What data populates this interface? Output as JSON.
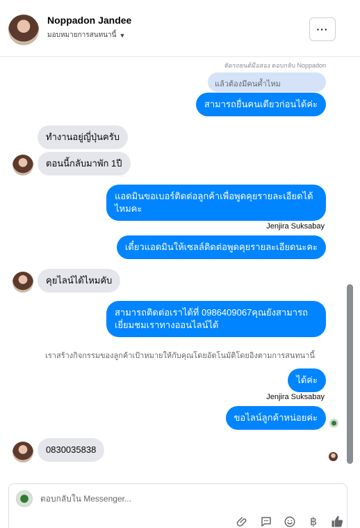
{
  "header": {
    "name": "Noppadon Jandee",
    "subtitle": "มอบหมายการสนทนานี้",
    "more_label": "···"
  },
  "messages": {
    "reply_context": "ตัดรถยนต์มือสอง ตอบกลับ Noppadon",
    "quoted_text": "แล้วต้องมีคนค้ำไหม",
    "m1": "สามารถยื่นคนเดียวก่อนได้ค่ะ",
    "m2": "ทำงานอยู่ญี่ปุ่นครับ",
    "m3": "ตอนนี้กลับมาพัก 1ปี",
    "m4": "แอดมินขอเบอร์ติดต่อลูกค้าเพื่อพูดคุยรายละเอียดได้ไหมคะ",
    "m4_sender": "Jenjira Suksabay",
    "m5": "เดี๋ยวแอดมินให้เซลล์ติดต่อพูดคุยรายละเอียดนะคะ",
    "m6": "คุยไลน์ได้ไหมคับ",
    "m7": "สามารถติดต่อเราได้ที่ 0986409067คุณยังสามารถเยี่ยมชมเราทางออนไลน์ได้",
    "system_note": "เราสร้างกิจกรรมของลูกค้าเป้าหมายให้กับคุณโดยอัตโนมัติโดยอิงตามการสนทนานี้",
    "m8": "ได้ค่ะ",
    "m8_sender": "Jenjira Suksabay",
    "m9": "ขอไลน์ลูกค้าหน่อยค่ะ",
    "m10": "0830035838"
  },
  "composer": {
    "placeholder": "ตอบกลับใน Messenger..."
  },
  "icons": [
    "paperclip-icon",
    "chat-bubble-icon",
    "emoji-icon",
    "baht-icon",
    "thumbs-up-icon"
  ],
  "colors": {
    "outgoing_bubble": "#0084ff",
    "incoming_bubble": "#e4e6eb",
    "quoted_bubble": "#d4e3f7"
  }
}
